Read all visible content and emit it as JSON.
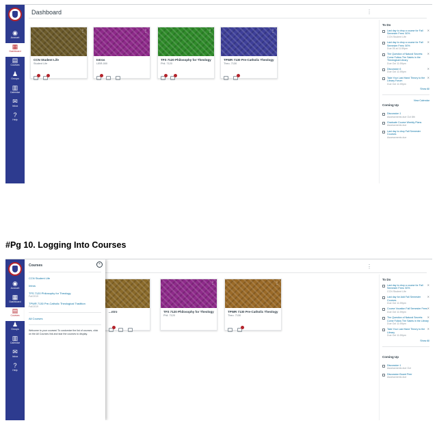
{
  "screen1": {
    "page_title": "Dashboard",
    "nav": [
      {
        "label": "Account",
        "icon": "account-icon"
      },
      {
        "label": "Dashboard",
        "icon": "dashboard-icon"
      },
      {
        "label": "Courses",
        "icon": "courses-icon"
      },
      {
        "label": "Groups",
        "icon": "groups-icon"
      },
      {
        "label": "Calendar",
        "icon": "calendar-icon"
      },
      {
        "label": "Inbox",
        "icon": "inbox-icon"
      },
      {
        "label": "Help",
        "icon": "help-icon"
      }
    ],
    "cards": [
      {
        "title": "CCN Student Life",
        "sub": "Student Life",
        "color": "#6b5a2a"
      },
      {
        "title": "Intros",
        "sub": "LIBR-000",
        "color": "#8e2a8a"
      },
      {
        "title": "TFS 7120 Philosophy for Theology",
        "sub": "Phil. 7120",
        "color": "#2f8a2a"
      },
      {
        "title": "TPWR 7130 Pre-Catholic Theology",
        "sub": "Theo. 7130",
        "color": "#3e3f98"
      }
    ],
    "todo_heading": "To Do",
    "todos": [
      {
        "link": "Last day to drop a course for Fall Semester Fees: 50%",
        "meta": "CCN Student Life"
      },
      {
        "link": "Last day to drop a course for Fall Semester Fees: 50%",
        "meta": "Due 05 at 11:59pm"
      },
      {
        "link": "The Question of Natural Secrets: Come Follow The Saints in the Theological Library",
        "meta": "Due Oct 11:59pm"
      },
      {
        "link": "Discussion 6",
        "meta": "Due Oct 11:59pm"
      },
      {
        "link": "Take Your Last Hand Theory to the Library Forum",
        "meta": "Due Oct 11:59pm"
      }
    ],
    "show_all": "Show All",
    "coming_heading": "Coming Up",
    "view_calendar": "View Calendar",
    "coming": [
      {
        "link": "Discussion 1",
        "meta": "Assessments due Oct 8th"
      },
      {
        "link": "Graduate Course Weekly Plans",
        "meta": "Assessments due"
      },
      {
        "link": "Last day to drop Fall Semester Courses",
        "meta": "Assessments due"
      }
    ]
  },
  "caption": "#Pg 10. Logging Into Courses",
  "screen2": {
    "page_title": "Dashboard",
    "tray": {
      "title": "Courses",
      "close": "×",
      "courses": [
        {
          "name": "CCN Student Life",
          "meta": ""
        },
        {
          "name": "Intros",
          "meta": ""
        },
        {
          "name": "TFS 7120 Philosophy for Theology",
          "meta": "Fall 2019"
        },
        {
          "name": "TPWR 7130 Pre-Catholic Theological Tradition",
          "meta": "Fall 2019"
        }
      ],
      "all_courses": "All Courses",
      "note": "Welcome to your courses! To customize the list of courses, click on the All Courses link and star the courses to display."
    },
    "nav": [
      {
        "label": "Account",
        "icon": "account-icon"
      },
      {
        "label": "Dashboard",
        "icon": "dashboard-icon"
      },
      {
        "label": "Courses",
        "icon": "courses-icon"
      },
      {
        "label": "Groups",
        "icon": "groups-icon"
      },
      {
        "label": "Calendar",
        "icon": "calendar-icon"
      },
      {
        "label": "Inbox",
        "icon": "inbox-icon"
      },
      {
        "label": "Help",
        "icon": "help-icon"
      }
    ],
    "cards": [
      {
        "title": "...ntro",
        "sub": "",
        "color": "#8a6a2a"
      },
      {
        "title": "TFS 7120 Philosophy for Theology",
        "sub": "Phil. 7120",
        "color": "#8e2a8a"
      },
      {
        "title": "TPWR 7130 Pre-Catholic Theology",
        "sub": "Theo. 7130",
        "color": "#9a6a28"
      }
    ],
    "todo_heading": "To Do",
    "todos": [
      {
        "link": "Last day to drop a course for Fall Semester Fees: 50%",
        "meta": "CCN Student Life"
      },
      {
        "link": "Last day for Add Fall Semester Courses",
        "meta": "Due Oct 11:59pm"
      },
      {
        "link": "Course Vocation Fall Semester Fees",
        "meta": "Due Oct 11:59pm"
      },
      {
        "link": "The Question of Natural Secrets: Come Follow The Saints in the Library",
        "meta": "Due Oct 11:59pm"
      },
      {
        "link": "Take Your Last Hand Theory to the Library",
        "meta": "Due Oct 11:59pm"
      }
    ],
    "show_all": "Show All",
    "coming_heading": "Coming Up",
    "coming": [
      {
        "link": "Discussion 1",
        "meta": "Assessments due Oct"
      },
      {
        "link": "Discussion Board Peer",
        "meta": "Assessments due"
      }
    ]
  }
}
